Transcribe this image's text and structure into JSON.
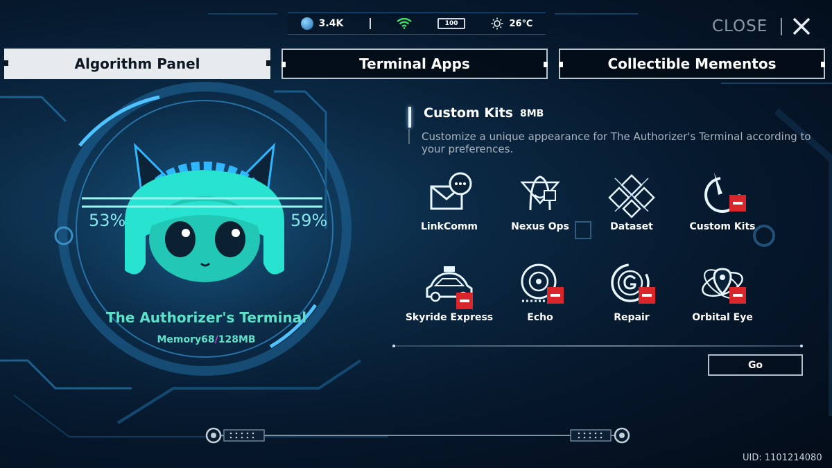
{
  "status_bar": {
    "credits": "3.4K",
    "battery": "100",
    "temperature": "26℃"
  },
  "close": {
    "label": "CLOSE"
  },
  "tabs": [
    {
      "label": "Algorithm Panel",
      "active": true
    },
    {
      "label": "Terminal Apps",
      "active": false
    },
    {
      "label": "Collectible Mementos",
      "active": false
    }
  ],
  "terminal": {
    "left_percent": "53%",
    "right_percent": "59%",
    "name": "The Authorizer's Terminal",
    "memory_label": "Memory",
    "memory_used": "68",
    "memory_separator": "/",
    "memory_total": "128MB"
  },
  "selected_kit": {
    "title": "Custom Kits",
    "size": "8MB",
    "description": "Customize a unique appearance for The Authorizer's Terminal according to your preferences."
  },
  "apps": [
    {
      "label": "LinkComm",
      "icon": "mail-chat-icon",
      "locked": false
    },
    {
      "label": "Nexus Ops",
      "icon": "hooded-figure-icon",
      "locked": false
    },
    {
      "label": "Dataset",
      "icon": "diamond-grid-icon",
      "locked": false
    },
    {
      "label": "Custom Kits",
      "icon": "brush-circle-icon",
      "locked": true
    },
    {
      "label": "Skyride Express",
      "icon": "taxi-icon",
      "locked": true
    },
    {
      "label": "Echo",
      "icon": "music-disc-icon",
      "locked": true
    },
    {
      "label": "Repair",
      "icon": "g-circle-icon",
      "locked": true
    },
    {
      "label": "Orbital Eye",
      "icon": "location-orbit-icon",
      "locked": true
    }
  ],
  "go_button": {
    "label": "Go"
  },
  "uid": {
    "label": "UID:",
    "value": "1101214080"
  },
  "colors": {
    "accent_cyan": "#5fe0c8",
    "chibi_cyan": "#27e3cf",
    "glow_blue": "#4ec3ff",
    "lock_red": "#d8262b"
  }
}
